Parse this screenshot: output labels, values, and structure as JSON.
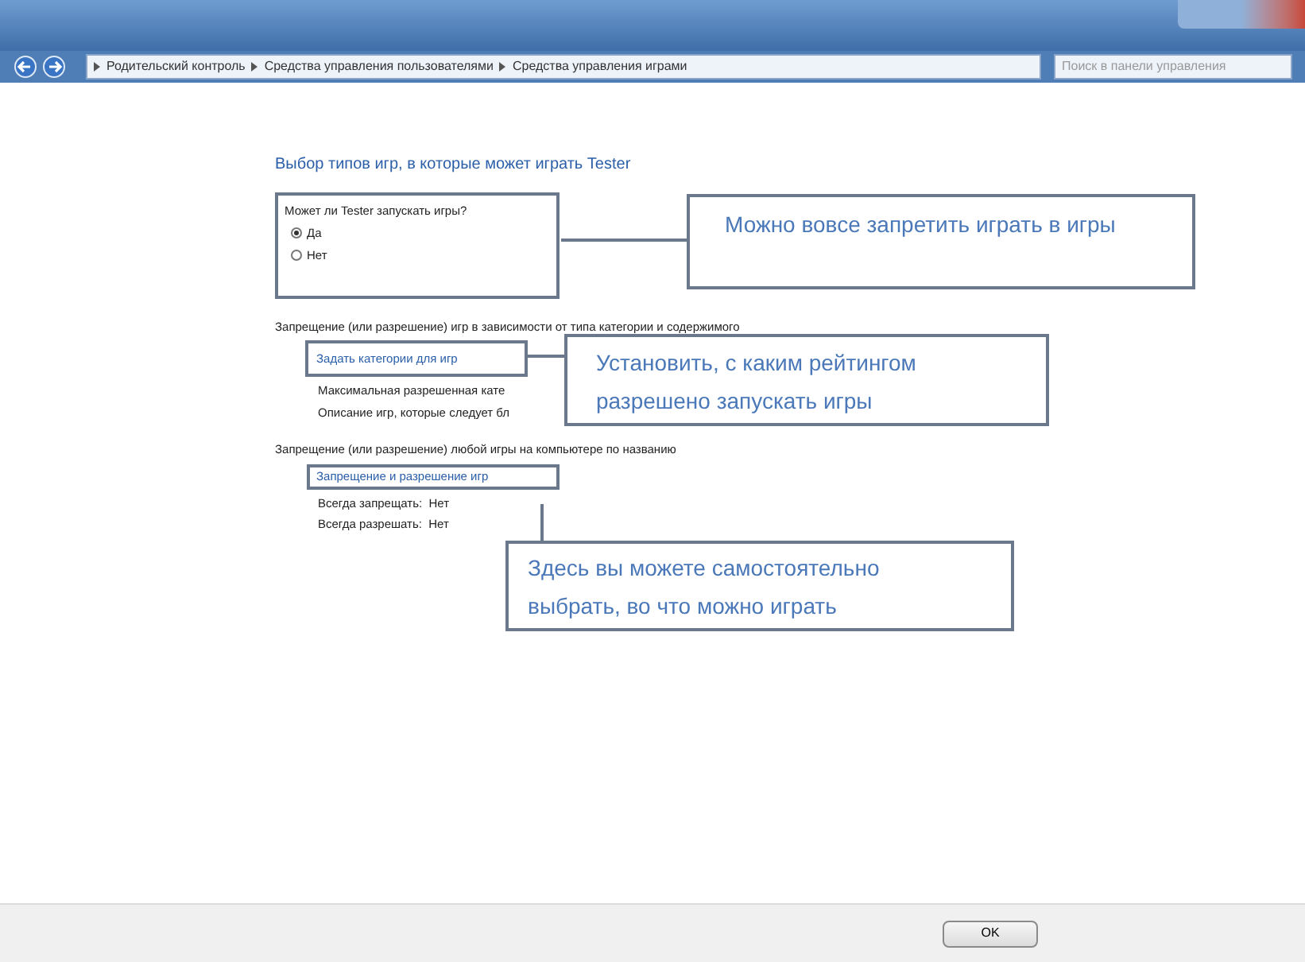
{
  "address_bar": {
    "breadcrumbs": [
      "Родительский контроль",
      "Средства управления пользователями",
      "Средства управления играми"
    ]
  },
  "search": {
    "placeholder": "Поиск в панели управления"
  },
  "heading": "Выбор типов игр, в которые может играть Tester",
  "question": {
    "label": "Может ли Tester запускать игры?",
    "options": [
      {
        "label": "Да",
        "selected": true
      },
      {
        "label": "Нет",
        "selected": false
      }
    ]
  },
  "ratings": {
    "heading": "Запрещение (или разрешение) игр в зависимости от типа категории и содержимого",
    "link": "Задать категории для игр",
    "lines": [
      "Максимальная разрешенная кате",
      "Описание игр, которые следует бл"
    ]
  },
  "titles": {
    "heading": "Запрещение (или разрешение) любой игры на компьютере по названию",
    "link": "Запрещение и разрешение игр",
    "lines": [
      "Всегда запрещать:  Нет",
      "Всегда разрешать:  Нет"
    ]
  },
  "callouts": [
    "Можно вовсе запретить играть в игры",
    "Установить, с каким рейтингом разрешено запускать игры",
    "Здесь вы можете самостоятельно выбрать, во что можно играть"
  ],
  "ok_button": "OK"
}
